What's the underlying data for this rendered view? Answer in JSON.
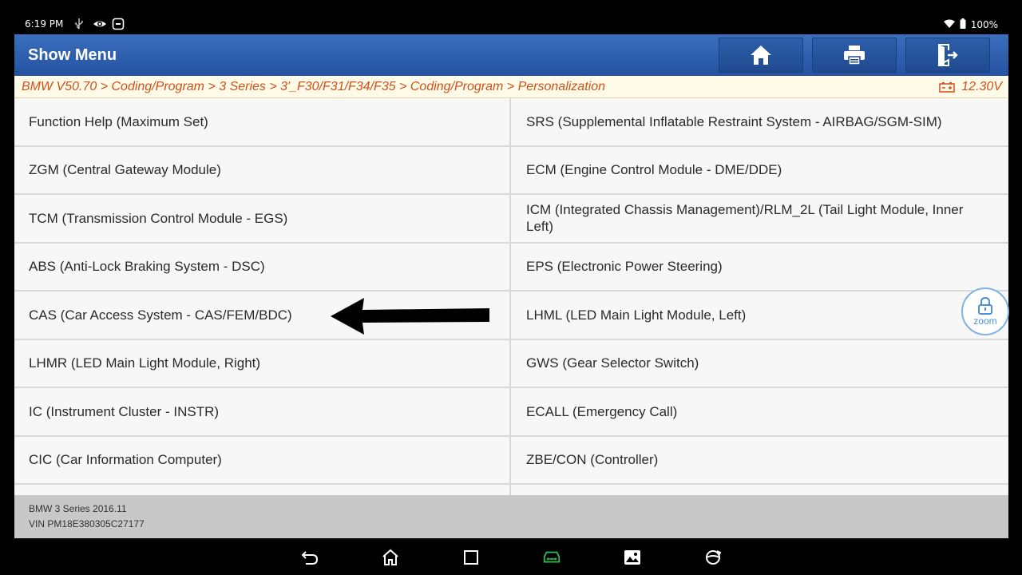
{
  "statusbar": {
    "time": "6:19 PM",
    "battery": "100%"
  },
  "header": {
    "title": "Show Menu"
  },
  "toolbar": {
    "home": "home-icon",
    "print": "printer-icon",
    "exit": "exit-icon"
  },
  "breadcrumb": {
    "path": "BMW V50.70 > Coding/Program > 3 Series > 3'_F30/F31/F34/F35 > Coding/Program > Personalization",
    "voltage": "12.30V"
  },
  "menu": {
    "items": [
      "Function Help (Maximum Set)",
      "SRS (Supplemental Inflatable Restraint System - AIRBAG/SGM-SIM)",
      "ZGM (Central Gateway Module)",
      "ECM (Engine Control Module - DME/DDE)",
      "TCM (Transmission Control Module - EGS)",
      "ICM (Integrated Chassis Management)/RLM_2L (Tail Light Module, Inner Left)",
      "ABS (Anti-Lock Braking System - DSC)",
      "EPS (Electronic Power Steering)",
      "CAS (Car Access System - CAS/FEM/BDC)",
      "LHML (LED Main Light Module, Left)",
      "LHMR (LED Main Light Module, Right)",
      "GWS (Gear Selector Switch)",
      "IC (Instrument Cluster - INSTR)",
      "ECALL (Emergency Call)",
      "CIC (Car Information Computer)",
      "ZBE/CON (Controller)"
    ]
  },
  "footer": {
    "model": "BMW 3 Series 2016.11",
    "vin": "VIN PM18E380305C27177"
  },
  "zoom": {
    "label": "zoom"
  },
  "colors": {
    "titlebar": "#2b5eab",
    "breadcrumb_text": "#d0501a",
    "zoom_accent": "#4d8fd6"
  }
}
